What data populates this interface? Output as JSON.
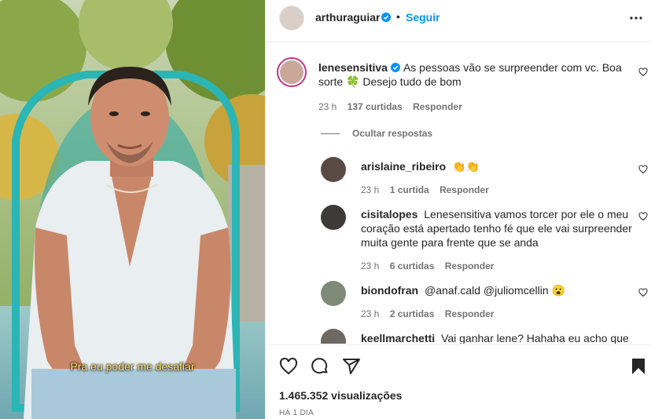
{
  "post": {
    "author": "arthuraguiar",
    "separator": "•",
    "follow_label": "Seguir",
    "video_caption": "Pra eu poder me desafiar"
  },
  "main_comment": {
    "username": "lenesensitiva",
    "text": "As pessoas vão se surpreender com vc. Boa sorte 🍀 Desejo tudo de bom",
    "time": "23 h",
    "likes": "137 curtidas",
    "reply_label": "Responder",
    "hide_replies_label": "Ocultar respostas"
  },
  "replies": [
    {
      "username": "arislaine_ribeiro",
      "text": "👏👏",
      "time": "23 h",
      "likes": "1 curtida",
      "reply_label": "Responder"
    },
    {
      "username": "cisitalopes",
      "text": "Lenesensitiva vamos torcer por ele o meu coração está apertado tenho fé que ele vai surpreender muita gente para frente que se anda",
      "time": "23 h",
      "likes": "6 curtidas",
      "reply_label": "Responder"
    },
    {
      "username": "biondofran",
      "text": "@anaf.cald @juliomcellin 😮",
      "time": "23 h",
      "likes": "2 curtidas",
      "reply_label": "Responder"
    },
    {
      "username": "keellmarchetti",
      "text": "Vai ganhar lene? Hahaha eu acho que"
    }
  ],
  "footer": {
    "views": "1.465.352 visualizações",
    "posted_ago": "HÁ 1 DIA"
  },
  "colors": {
    "link": "#0095f6",
    "verified": "#0095f6",
    "caption": "#ffe66a",
    "muted": "#737373"
  },
  "icons": [
    "verified-icon",
    "more-options-icon",
    "heart-icon",
    "comment-icon",
    "share-icon",
    "bookmark-icon"
  ]
}
